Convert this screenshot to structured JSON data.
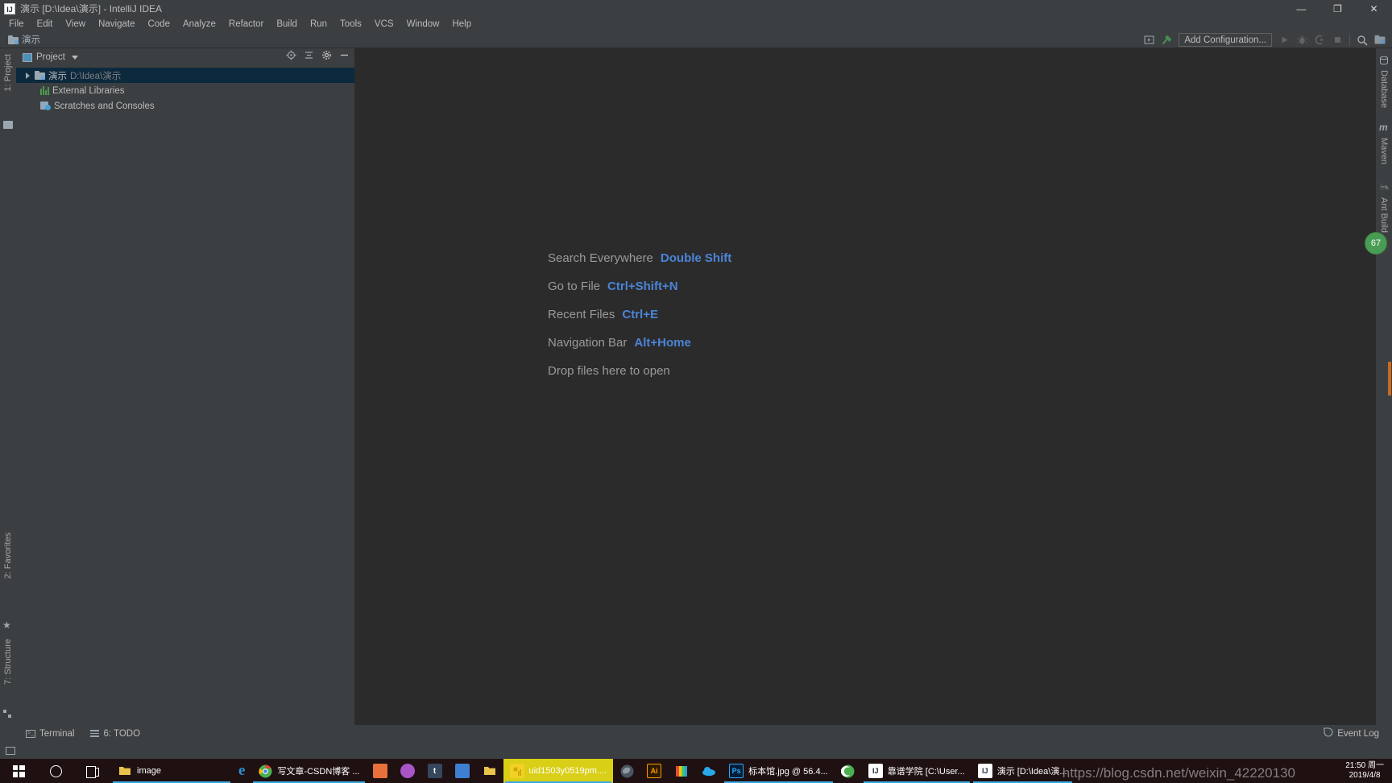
{
  "window": {
    "title": "演示 [D:\\Idea\\演示] - IntelliJ IDEA",
    "app_icon": "IJ",
    "minimize": "—",
    "maximize": "❐",
    "close": "✕"
  },
  "menubar": {
    "items": [
      {
        "label": "File"
      },
      {
        "label": "Edit"
      },
      {
        "label": "View"
      },
      {
        "label": "Navigate"
      },
      {
        "label": "Code"
      },
      {
        "label": "Analyze"
      },
      {
        "label": "Refactor"
      },
      {
        "label": "Build"
      },
      {
        "label": "Run"
      },
      {
        "label": "Tools"
      },
      {
        "label": "VCS"
      },
      {
        "label": "Window"
      },
      {
        "label": "Help"
      }
    ]
  },
  "navbar": {
    "breadcrumb": "演示",
    "add_configuration": "Add Configuration...",
    "icons": {
      "select_in": "select-in-icon",
      "build": "hammer-icon",
      "run": "run-icon",
      "debug": "debug-icon",
      "run_coverage": "run-coverage-icon",
      "stop": "stop-icon",
      "search": "search-icon",
      "project_structure": "project-structure-icon"
    }
  },
  "left_strip": {
    "top_items": [
      {
        "label": "1: Project",
        "icon": "project-icon"
      }
    ],
    "bottom_items": [
      {
        "label": "2: Favorites",
        "icon": "star-icon"
      },
      {
        "label": "7: Structure",
        "icon": "structure-icon"
      }
    ]
  },
  "right_strip": {
    "items": [
      {
        "label": "Database",
        "icon": "database-icon"
      },
      {
        "label": "Maven",
        "icon": "maven-icon"
      },
      {
        "label": "Ant Build",
        "icon": "ant-icon"
      }
    ]
  },
  "project_panel": {
    "title": "Project",
    "actions": [
      {
        "name": "locate-icon",
        "glyph": "⊕"
      },
      {
        "name": "collapse-all-icon",
        "glyph": "⇥"
      },
      {
        "name": "settings-gear-icon",
        "glyph": "⚙"
      },
      {
        "name": "hide-icon",
        "glyph": "—"
      }
    ],
    "tree": [
      {
        "label": "演示",
        "path": "D:\\Idea\\演示",
        "icon": "module-folder-icon",
        "expandable": true,
        "selected": true
      },
      {
        "label": "External Libraries",
        "path": "",
        "icon": "libraries-icon",
        "expandable": false,
        "selected": false
      },
      {
        "label": "Scratches and Consoles",
        "path": "",
        "icon": "scratches-icon",
        "expandable": false,
        "selected": false
      }
    ]
  },
  "editor": {
    "hints": [
      {
        "label": "Search Everywhere",
        "key": "Double Shift"
      },
      {
        "label": "Go to File",
        "key": "Ctrl+Shift+N"
      },
      {
        "label": "Recent Files",
        "key": "Ctrl+E"
      },
      {
        "label": "Navigation Bar",
        "key": "Alt+Home"
      }
    ],
    "drop_hint": "Drop files here to open",
    "inspection_badge": "67",
    "accent_key_color": "#4b84d8",
    "hint_text_color": "#9a9a9a",
    "badge_color": "#499c54"
  },
  "statusbar": {
    "left_items": [
      {
        "label": "Terminal",
        "icon": "terminal-icon"
      },
      {
        "label": "6: TODO",
        "icon": "todo-icon"
      }
    ],
    "right_items": [
      {
        "label": "Event Log",
        "icon": "event-log-icon"
      }
    ]
  },
  "taskbar": {
    "system": [
      {
        "name": "start-button",
        "icon": "windows-logo-icon"
      },
      {
        "name": "cortana-search",
        "icon": "circle-icon"
      },
      {
        "name": "task-view",
        "icon": "task-view-icon"
      }
    ],
    "items": [
      {
        "label": "image",
        "icon": "folder-icon",
        "color": "#e8c44d",
        "active": true,
        "highlight": false
      },
      {
        "label": "",
        "icon": "edge-icon",
        "color": "#2b8fd6",
        "active": false,
        "highlight": false
      },
      {
        "label": "写文章-CSDN博客 ...",
        "icon": "chrome-icon",
        "color": "#4285f4",
        "active": true,
        "highlight": false
      },
      {
        "label": "",
        "icon": "app-orange-icon",
        "color": "#e8703a",
        "active": false,
        "highlight": false
      },
      {
        "label": "",
        "icon": "app-purple-icon",
        "color": "#a855c8",
        "active": false,
        "highlight": false
      },
      {
        "label": "",
        "icon": "tumblr-icon",
        "color": "#36465d",
        "active": false,
        "highlight": false
      },
      {
        "label": "",
        "icon": "app-blue-icon",
        "color": "#3f7fd0",
        "active": false,
        "highlight": false
      },
      {
        "label": "",
        "icon": "explorer-icon",
        "color": "#e8c44d",
        "active": false,
        "highlight": false
      },
      {
        "label": "uid1503y0519pm....",
        "icon": "media-icon",
        "color": "#f2d024",
        "active": true,
        "highlight": true
      },
      {
        "label": "",
        "icon": "cinema4d-icon",
        "color": "#5a6470",
        "active": false,
        "highlight": false
      },
      {
        "label": "",
        "icon": "illustrator-icon",
        "color": "#ff9a00",
        "active": false,
        "highlight": false
      },
      {
        "label": "",
        "icon": "notes-icon",
        "color": "#6fbf4a",
        "active": false,
        "highlight": false
      },
      {
        "label": "",
        "icon": "onedrive-icon",
        "color": "#28a8ea",
        "active": false,
        "highlight": false
      },
      {
        "label": "标本馆.jpg @ 56.4...",
        "icon": "photoshop-icon",
        "color": "#31a8ff",
        "active": true,
        "highlight": false
      },
      {
        "label": "",
        "icon": "browser-green-icon",
        "color": "#4caf50",
        "active": false,
        "highlight": false
      },
      {
        "label": "靠谱学院 [C:\\User...",
        "icon": "intellij-icon",
        "color": "#3d5afe",
        "active": true,
        "highlight": false
      },
      {
        "label": "演示 [D:\\Idea\\演...",
        "icon": "intellij-icon",
        "color": "#3d5afe",
        "active": true,
        "highlight": false
      }
    ],
    "clock": {
      "time": "21:50 周一",
      "date": "2019/4/8"
    }
  },
  "watermarks": {
    "main": "https://blog.csdn.net/weixin_42220130",
    "secondary": ""
  }
}
